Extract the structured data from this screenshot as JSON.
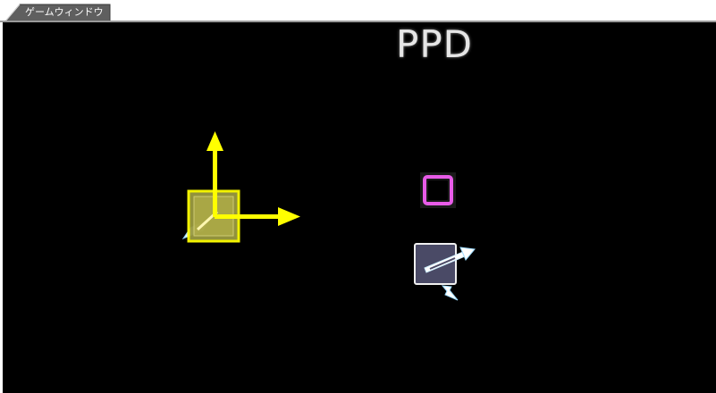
{
  "window": {
    "tab_label": "ゲームウィンドウ"
  },
  "hud": {
    "title": "PPD"
  },
  "icons": {
    "gizmo": "move-gizmo-icon",
    "selected_object": "selected-note-icon",
    "pink_square": "square-target-icon",
    "slider_note": "slide-note-icon"
  },
  "colors": {
    "viewport_bg": "#000000",
    "gizmo": "#ffff00",
    "square_target": "#e85ce8",
    "slide_note_fill": "#4a4a66",
    "tab_bg": "#5a5a5a",
    "title_text": "#e6e6e6"
  }
}
